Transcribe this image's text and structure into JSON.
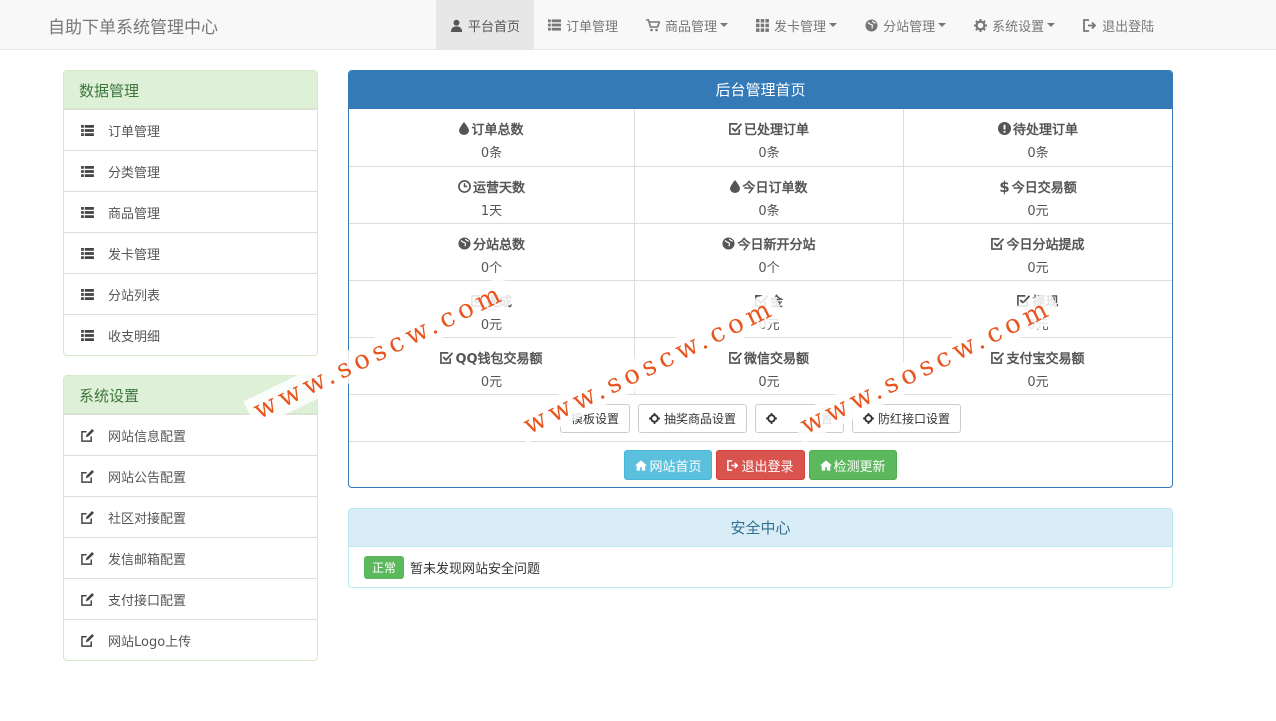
{
  "brand": "自助下单系统管理中心",
  "nav": [
    {
      "label": "平台首页",
      "icon": "user-icon",
      "active": true,
      "caret": false
    },
    {
      "label": "订单管理",
      "icon": "list-icon",
      "active": false,
      "caret": false
    },
    {
      "label": "商品管理",
      "icon": "cart-icon",
      "active": false,
      "caret": true
    },
    {
      "label": "发卡管理",
      "icon": "grid-icon",
      "active": false,
      "caret": true
    },
    {
      "label": "分站管理",
      "icon": "globe-icon",
      "active": false,
      "caret": true
    },
    {
      "label": "系统设置",
      "icon": "gear-icon",
      "active": false,
      "caret": true
    },
    {
      "label": "退出登陆",
      "icon": "logout-icon",
      "active": false,
      "caret": false
    }
  ],
  "data_panel": {
    "title": "数据管理",
    "items": [
      "订单管理",
      "分类管理",
      "商品管理",
      "发卡管理",
      "分站列表",
      "收支明细"
    ]
  },
  "settings_panel": {
    "title": "系统设置",
    "items": [
      "网站信息配置",
      "网站公告配置",
      "社区对接配置",
      "发信邮箱配置",
      "支付接口配置",
      "网站Logo上传"
    ]
  },
  "main": {
    "title": "后台管理首页",
    "stats": [
      {
        "label": "订单总数",
        "value": "0条",
        "icon": "tint-icon"
      },
      {
        "label": "已处理订单",
        "value": "0条",
        "icon": "check-icon"
      },
      {
        "label": "待处理订单",
        "value": "0条",
        "icon": "exclamation-icon"
      },
      {
        "label": "运营天数",
        "value": "1天",
        "icon": "clock-icon"
      },
      {
        "label": "今日订单数",
        "value": "0条",
        "icon": "tint-icon"
      },
      {
        "label": "今日交易额",
        "value": "0元",
        "icon": "dollar-icon"
      },
      {
        "label": "分站总数",
        "value": "0个",
        "icon": "globe-icon"
      },
      {
        "label": "今日新开分站",
        "value": "0个",
        "icon": "globe-icon"
      },
      {
        "label": "今日分站提成",
        "value": "0元",
        "icon": "check-icon"
      },
      {
        "label": "提成",
        "value": "0元",
        "icon": "check-icon"
      },
      {
        "label": "金",
        "value": "0元",
        "icon": "check-icon"
      },
      {
        "label": "提现",
        "value": "0元",
        "icon": "check-icon"
      },
      {
        "label": "QQ钱包交易额",
        "value": "0元",
        "icon": "check-icon"
      },
      {
        "label": "微信交易额",
        "value": "0元",
        "icon": "check-icon"
      },
      {
        "label": "支付宝交易额",
        "value": "0元",
        "icon": "check-icon"
      }
    ],
    "settings_buttons": [
      "模板设置",
      "抽奖商品设置",
      "置",
      "防红接口设置"
    ],
    "action_buttons": [
      {
        "label": "网站首页",
        "style": "btn-info",
        "icon": "home-icon"
      },
      {
        "label": "退出登录",
        "style": "btn-danger",
        "icon": "logout-icon"
      },
      {
        "label": "检测更新",
        "style": "btn-success",
        "icon": "home-icon"
      }
    ]
  },
  "security": {
    "title": "安全中心",
    "badge": "正常",
    "message": "暂未发现网站安全问题"
  },
  "watermark": "www.soscw.com"
}
